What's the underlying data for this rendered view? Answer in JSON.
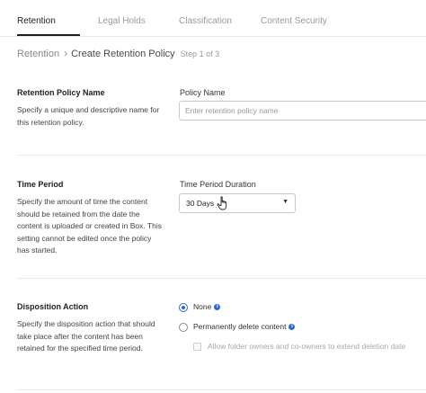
{
  "tabs": [
    {
      "label": "Retention",
      "active": true
    },
    {
      "label": "Legal Holds",
      "active": false
    },
    {
      "label": "Classification",
      "active": false
    },
    {
      "label": "Content Security",
      "active": false
    }
  ],
  "breadcrumb": {
    "parent": "Retention",
    "current": "Create Retention Policy",
    "step": "Step 1 of 3"
  },
  "policy_name": {
    "title": "Retention Policy Name",
    "description": "Specify a unique and descriptive name for this retention policy.",
    "field_label": "Policy Name",
    "placeholder": "Enter retention policy name",
    "value": ""
  },
  "time_period": {
    "title": "Time Period",
    "description": "Specify the amount of time the content should be retained from the date the content is uploaded or created in Box. This setting cannot be edited once the policy has started.",
    "field_label": "Time Period Duration",
    "selected": "30 Days"
  },
  "disposition": {
    "title": "Disposition Action",
    "description": "Specify the disposition action that should take place after the content has been retained for the specified time period.",
    "options": [
      {
        "label": "None",
        "checked": true
      },
      {
        "label": "Permanently delete content",
        "checked": false
      }
    ],
    "extend_checkbox": {
      "label": "Allow folder owners and co-owners to extend deletion date",
      "checked": false,
      "disabled": true
    }
  },
  "colors": {
    "accent": "#2a6bd1",
    "active_tab_underline": "#1f1f1f"
  },
  "icons": {
    "info": "info-icon",
    "cursor": "hand-pointer-icon",
    "caret": "caret-down-icon"
  }
}
